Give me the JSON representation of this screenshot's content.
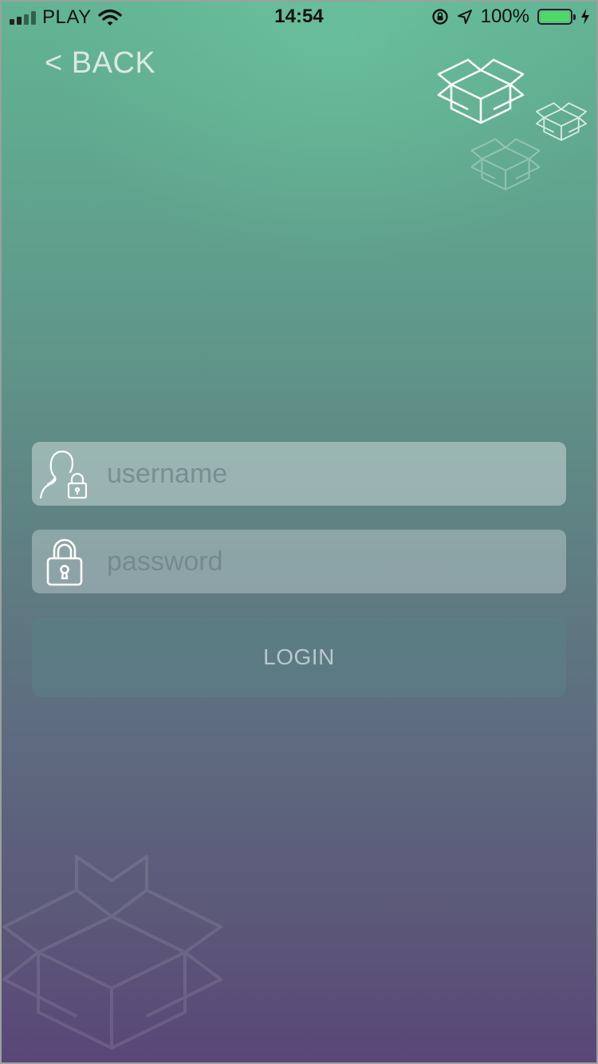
{
  "status_bar": {
    "carrier": "PLAY",
    "time": "14:54",
    "battery_percent": "100%",
    "battery_level": 1.0
  },
  "nav": {
    "back_label": "< BACK"
  },
  "login_form": {
    "username_placeholder": "username",
    "password_placeholder": "password",
    "login_label": "LOGIN"
  },
  "icons": {
    "username": "user-lock-icon",
    "password": "padlock-icon",
    "logo": "box-icon"
  },
  "colors": {
    "gradient_top": "#62b494",
    "gradient_bottom": "#5a4678",
    "battery_fill": "#4cd964"
  }
}
